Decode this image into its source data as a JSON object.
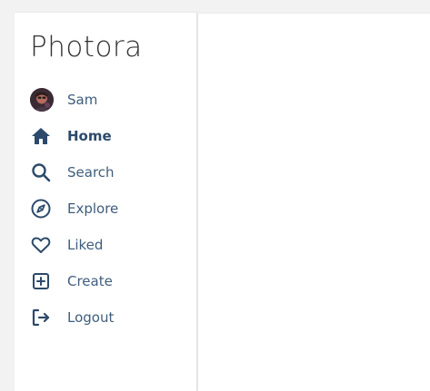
{
  "app": {
    "logo": "Photora"
  },
  "colors": {
    "accent": "#2c4a6b",
    "label": "#3f5d7d",
    "sidebar_bg": "#ffffff",
    "page_bg": "#f2f2f2"
  },
  "nav": {
    "items": [
      {
        "label": "Sam",
        "icon": "avatar"
      },
      {
        "label": "Home",
        "icon": "home-icon",
        "active": true
      },
      {
        "label": "Search",
        "icon": "search-icon"
      },
      {
        "label": "Explore",
        "icon": "compass-icon"
      },
      {
        "label": "Liked",
        "icon": "heart-icon"
      },
      {
        "label": "Create",
        "icon": "plus-square-icon"
      },
      {
        "label": "Logout",
        "icon": "logout-icon"
      }
    ]
  }
}
